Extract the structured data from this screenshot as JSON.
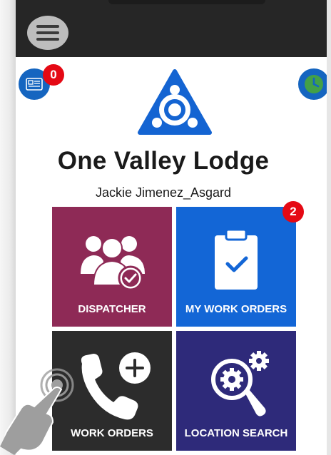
{
  "header": {
    "menu_icon": "hamburger-menu-icon"
  },
  "badges": {
    "id_card_icon": "id-card-icon",
    "id_card_count": "0",
    "clock_icon": "clock-icon"
  },
  "organization": {
    "name": "One Valley Lodge",
    "user": "Jackie Jimenez_Asgard"
  },
  "tiles": [
    {
      "label": "DISPATCHER",
      "icon": "users-check-icon",
      "color": "#8e2a56"
    },
    {
      "label": "MY WORK ORDERS",
      "icon": "clipboard-check-icon",
      "color": "#1366d6",
      "badge": "2"
    },
    {
      "label": "WORK ORDERS",
      "icon": "phone-add-icon",
      "color": "#2c2c2c"
    },
    {
      "label": "LOCATION SEARCH",
      "icon": "gear-search-icon",
      "color": "#2e2a7a"
    }
  ],
  "colors": {
    "topbar": "#262626",
    "accent_blue": "#1565c0",
    "badge_red": "#e50914"
  }
}
